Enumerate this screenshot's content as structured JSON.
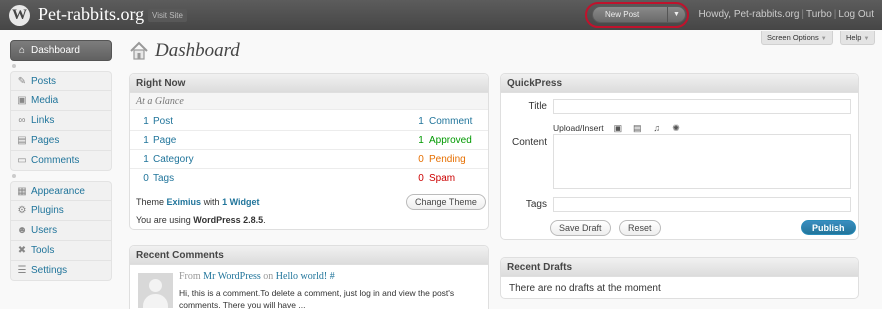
{
  "header": {
    "logo": "W",
    "site_title": "Pet-rabbits.org",
    "visit_site": "Visit Site",
    "favorite_action": "New Post",
    "greeting": "Howdy,",
    "user": "Pet-rabbits.org",
    "turbo": "Turbo",
    "logout": "Log Out"
  },
  "screen_meta": {
    "screen_options": "Screen Options",
    "help": "Help"
  },
  "sidebar": {
    "items": [
      {
        "label": "Dashboard",
        "icon": "home-icon"
      },
      {
        "label": "Posts",
        "icon": "pin-icon"
      },
      {
        "label": "Media",
        "icon": "media-icon"
      },
      {
        "label": "Links",
        "icon": "link-icon"
      },
      {
        "label": "Pages",
        "icon": "pages-icon"
      },
      {
        "label": "Comments",
        "icon": "comments-icon"
      },
      {
        "label": "Appearance",
        "icon": "appearance-icon"
      },
      {
        "label": "Plugins",
        "icon": "plugins-icon"
      },
      {
        "label": "Users",
        "icon": "users-icon"
      },
      {
        "label": "Tools",
        "icon": "tools-icon"
      },
      {
        "label": "Settings",
        "icon": "settings-icon"
      }
    ]
  },
  "page_title": "Dashboard",
  "right_now": {
    "title": "Right Now",
    "subtitle": "At a Glance",
    "rows": [
      {
        "num": "1",
        "label": "Post",
        "rnum": "1",
        "rlabel": "Comment"
      },
      {
        "num": "1",
        "label": "Page",
        "rnum": "1",
        "rlabel": "Approved"
      },
      {
        "num": "1",
        "label": "Category",
        "rnum": "0",
        "rlabel": "Pending"
      },
      {
        "num": "0",
        "label": "Tags",
        "rnum": "0",
        "rlabel": "Spam"
      }
    ],
    "theme_prefix": "Theme",
    "theme_name": "Eximius",
    "theme_with": "with",
    "widget_count": "1 Widget",
    "change_theme": "Change Theme",
    "version_prefix": "You are using",
    "version": "WordPress 2.8.5",
    "version_suffix": "."
  },
  "recent_comments": {
    "title": "Recent Comments",
    "from": "From",
    "author": "Mr WordPress",
    "on": "on",
    "post": "Hello world!",
    "permalink": "#",
    "excerpt": "Hi, this is a comment.To delete a comment, just log in and view the post's comments. There you will have ..."
  },
  "quickpress": {
    "title": "QuickPress",
    "title_label": "Title",
    "upload_label": "Upload/Insert",
    "content_label": "Content",
    "tags_label": "Tags",
    "save_draft": "Save Draft",
    "reset": "Reset",
    "publish": "Publish"
  },
  "recent_drafts": {
    "title": "Recent Drafts",
    "empty": "There are no drafts at the moment"
  },
  "colors": {
    "link": "#21759b",
    "approved": "#009900",
    "pending": "#e66f00",
    "spam": "#cc0000",
    "header_bg": "#464646",
    "highlight_ring": "#c0122c"
  }
}
